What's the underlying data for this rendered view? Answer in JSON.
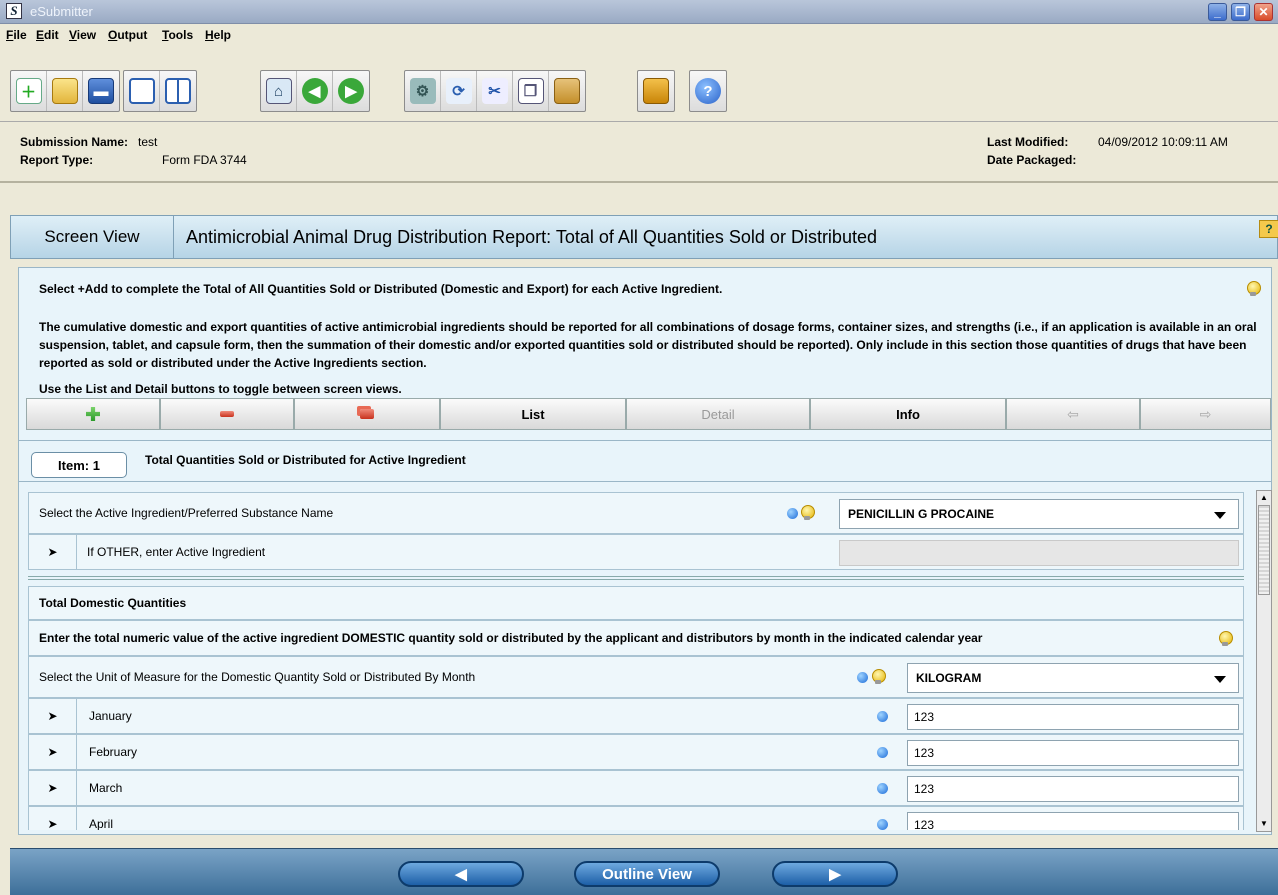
{
  "window": {
    "title": "eSubmitter",
    "app_icon": "S"
  },
  "menu": [
    "File",
    "Edit",
    "View",
    "Output",
    "Tools",
    "Help"
  ],
  "toolbar": {
    "groups": [
      [
        "new-document-icon",
        "open-folder-icon",
        "save-disk-icon"
      ],
      [
        "single-window-icon",
        "split-window-icon"
      ],
      [
        "home-icon",
        "back-arrow-icon",
        "forward-arrow-icon"
      ],
      [
        "settings-gears-icon",
        "refresh-icon",
        "cut-scissors-icon",
        "copy-icon",
        "paste-clipboard-icon"
      ],
      [
        "package-box-icon"
      ],
      [
        "help-question-icon"
      ]
    ]
  },
  "info": {
    "submission_name_label": "Submission Name:",
    "submission_name": "test",
    "report_type_label": "Report Type:",
    "report_type": "Form FDA 3744",
    "last_modified_label": "Last Modified:",
    "last_modified": "04/09/2012 10:09:11 AM",
    "date_packaged_label": "Date Packaged:",
    "date_packaged": ""
  },
  "header": {
    "screen_view": "Screen View",
    "report_title": "Antimicrobial Animal Drug Distribution Report: Total of All Quantities Sold or Distributed",
    "help_label": "?"
  },
  "instructions": {
    "line1": "Select +Add to complete the Total of All Quantities Sold or Distributed (Domestic and Export) for each Active Ingredient.",
    "line2": "The cumulative domestic and export quantities of active antimicrobial ingredients should be reported for all combinations of dosage forms, container sizes, and strengths (i.e., if an application is available in an oral suspension, tablet, and capsule form, then the summation of their domestic and/or exported quantities sold or distributed should be reported). Only include in this section those quantities of drugs that have been reported as sold or distributed under the Active Ingredients section.",
    "line3": "Use the List and Detail buttons to toggle between screen views."
  },
  "actions": {
    "list": "List",
    "detail": "Detail",
    "info": "Info"
  },
  "item": {
    "label": "Item: 1",
    "title": "Total Quantities Sold or Distributed for Active Ingredient"
  },
  "form": {
    "active_ingredient_label": "Select the Active Ingredient/Preferred Substance Name",
    "active_ingredient_value": "PENICILLIN G PROCAINE",
    "other_label": "If OTHER, enter Active Ingredient",
    "other_value": "",
    "domestic_header": "Total Domestic Quantities",
    "domestic_instruction": "Enter the total numeric value of the active ingredient DOMESTIC quantity sold or distributed by the applicant and distributors by month in the indicated calendar year",
    "uom_label": "Select the Unit of Measure for the Domestic Quantity Sold or Distributed By Month",
    "uom_value": "KILOGRAM",
    "months": [
      {
        "name": "January",
        "value": "123"
      },
      {
        "name": "February",
        "value": "123"
      },
      {
        "name": "March",
        "value": "123"
      },
      {
        "name": "April",
        "value": "123"
      }
    ]
  },
  "footer": {
    "outline_view": "Outline View"
  }
}
